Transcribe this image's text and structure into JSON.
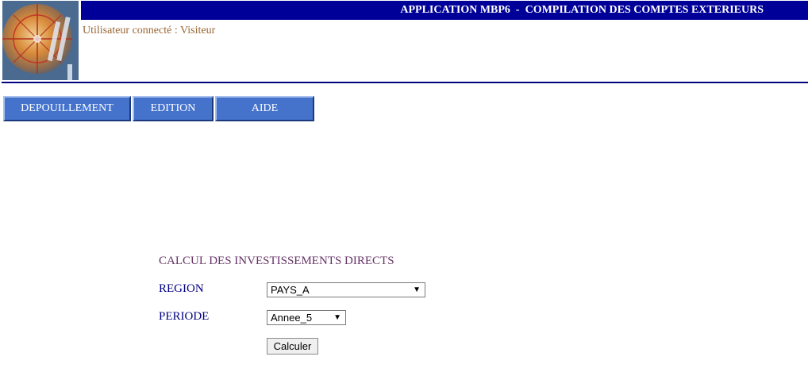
{
  "header": {
    "title": "APPLICATION MBP6  -  COMPILATION DES COMPTES EXTERIEURS",
    "user_status": "Utilisateur connecté : Visiteur"
  },
  "logo": {
    "icon": "compass-globe-logo"
  },
  "nav": {
    "items": [
      {
        "label": "DEPOUILLEMENT"
      },
      {
        "label": "EDITION"
      },
      {
        "label": "AIDE"
      }
    ]
  },
  "form": {
    "title": "CALCUL DES INVESTISSEMENTS DIRECTS",
    "region": {
      "label": "REGION",
      "value": "PAYS_A"
    },
    "periode": {
      "label": "PERIODE",
      "value": "Annee_5"
    },
    "submit_label": "Calculer"
  },
  "colors": {
    "title_bar": "#000099",
    "nav_button": "#4573cc",
    "user_text": "#996633",
    "form_title": "#663366",
    "field_label": "#000080"
  }
}
